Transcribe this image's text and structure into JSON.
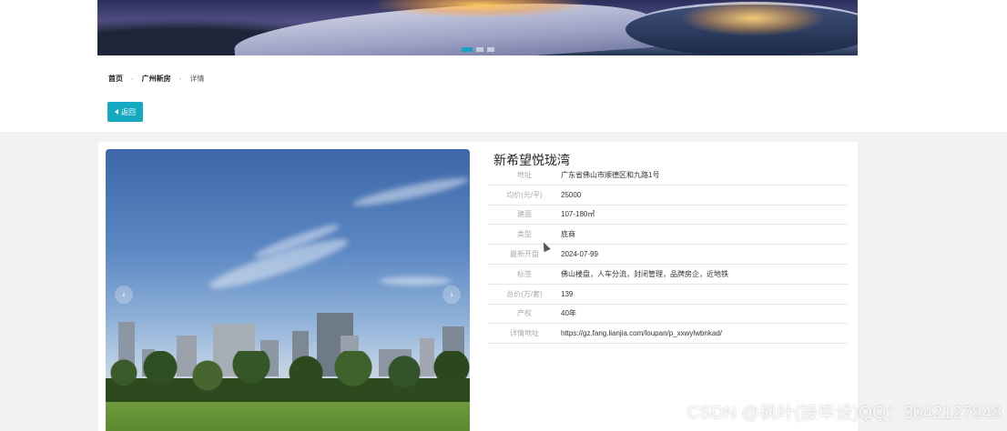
{
  "banner": {
    "slides_total": 3,
    "active_slide": 1
  },
  "breadcrumb": {
    "home": "首页",
    "sep": "-",
    "category": "广州新房",
    "current": "详情"
  },
  "back_button": {
    "label": "返回"
  },
  "property": {
    "name": "新希望悦珑湾",
    "details": [
      {
        "label": "地址",
        "value": "广东省佛山市顺德区和九路1号"
      },
      {
        "label": "均价(元/平)",
        "value": "25000"
      },
      {
        "label": "建面",
        "value": "107-180㎡"
      },
      {
        "label": "类型",
        "value": "底商"
      },
      {
        "label": "最新开盘",
        "value": "2024-07-99"
      },
      {
        "label": "标签",
        "value": "佛山楼盘，人车分流，封闭管理，品牌房企，近地铁"
      },
      {
        "label": "总价(万/套)",
        "value": "139"
      },
      {
        "label": "产权",
        "value": "40年"
      },
      {
        "label": "详情地址",
        "value": "https://gz.fang.lianjia.com/loupan/p_xxwylwbnkad/"
      }
    ]
  },
  "carousel": {
    "prev_icon": "‹",
    "next_icon": "›"
  },
  "watermark": "CSDN @枫叶(接毕设)QQ：3042127848",
  "colors": {
    "accent": "#16a9c2",
    "page_bg": "#f2f2f2"
  }
}
